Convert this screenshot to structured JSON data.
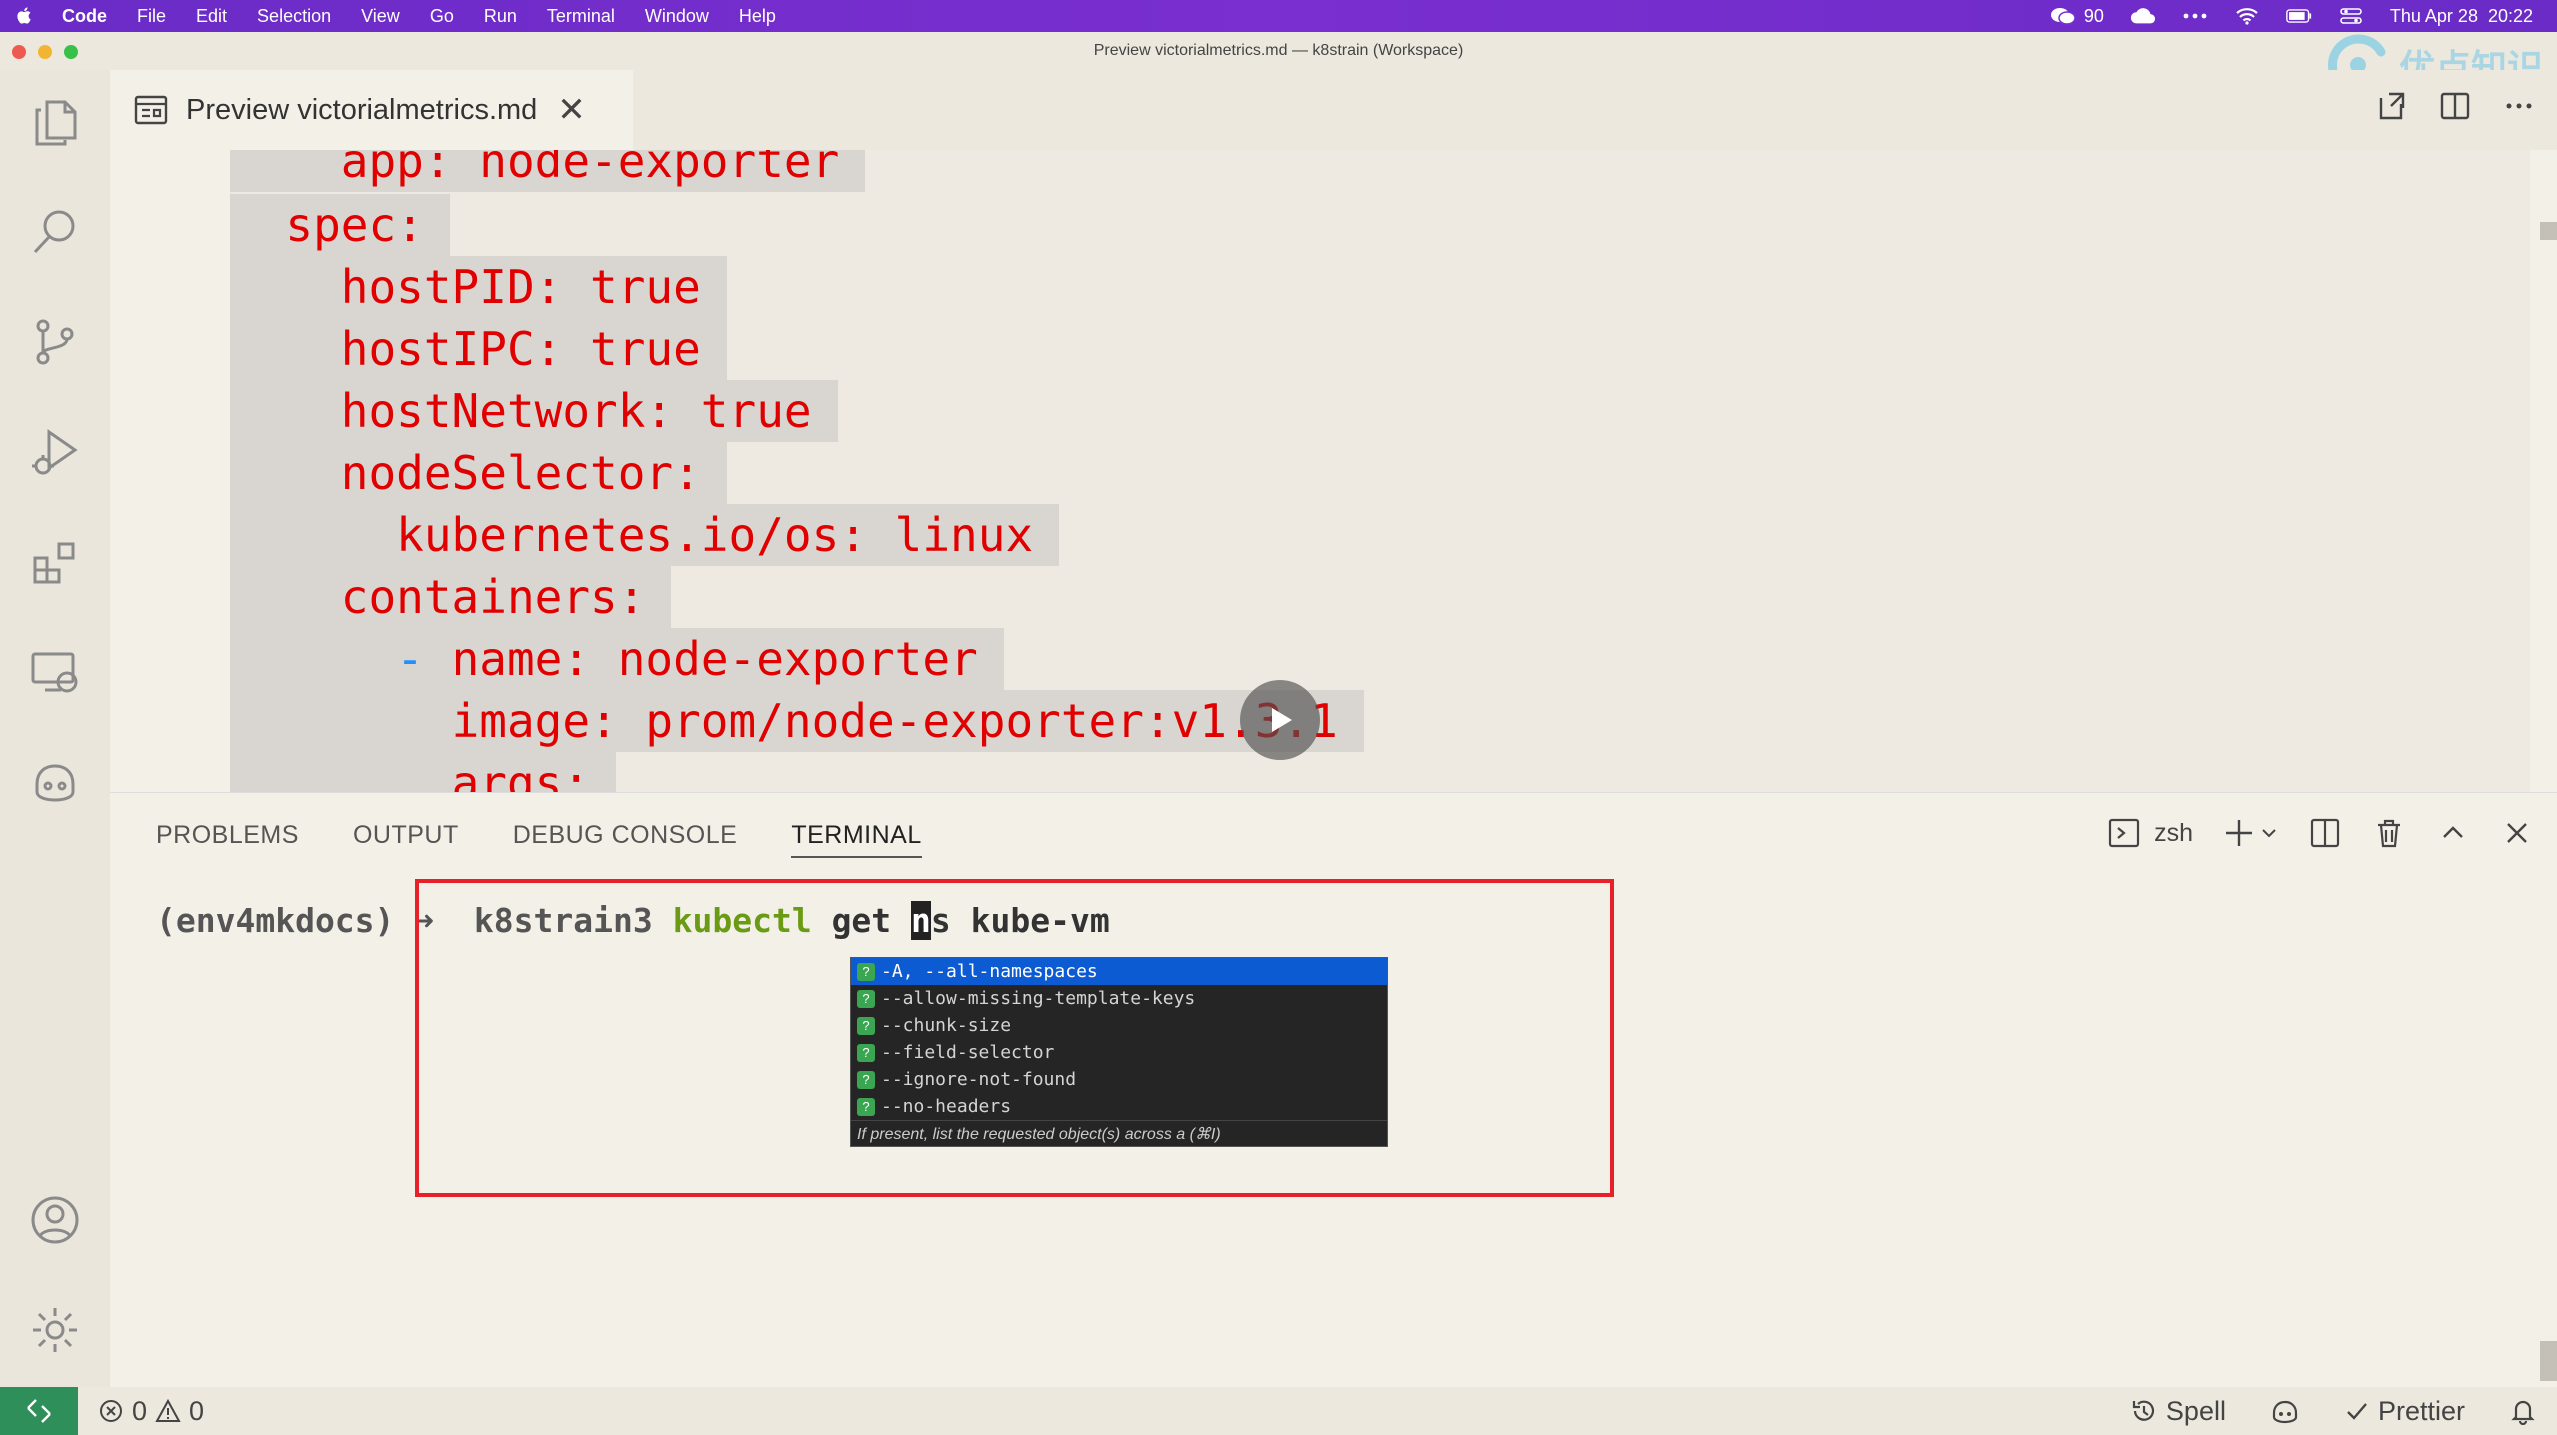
{
  "menubar": {
    "app": "Code",
    "items": [
      "File",
      "Edit",
      "Selection",
      "View",
      "Go",
      "Run",
      "Terminal",
      "Window",
      "Help"
    ],
    "wechat_count": "90",
    "datetime": "Thu Apr 28  20:22"
  },
  "window": {
    "title": "Preview victorialmetrics.md — k8strain (Workspace)"
  },
  "watermark": {
    "text": "优点知识"
  },
  "editor_tab": {
    "label": "Preview victorialmetrics.md",
    "close": "✕"
  },
  "code": {
    "lines": [
      {
        "indent": "    ",
        "text": "app: node-exporter"
      },
      {
        "indent": "  ",
        "text": "spec:"
      },
      {
        "indent": "    ",
        "text": "hostPID: true"
      },
      {
        "indent": "    ",
        "text": "hostIPC: true"
      },
      {
        "indent": "    ",
        "text": "hostNetwork: true"
      },
      {
        "indent": "    ",
        "text": "nodeSelector:"
      },
      {
        "indent": "      ",
        "text": "kubernetes.io/os: linux"
      },
      {
        "indent": "    ",
        "text": "containers:"
      },
      {
        "indent": "      ",
        "dash": "-",
        "text": " name: node-exporter"
      },
      {
        "indent": "        ",
        "text": "image: prom/node-exporter:v1.3.1"
      },
      {
        "indent": "        ",
        "text": "args:"
      }
    ]
  },
  "panel": {
    "tabs": [
      "PROBLEMS",
      "OUTPUT",
      "DEBUG CONSOLE",
      "TERMINAL"
    ],
    "active_tab": "TERMINAL",
    "shell": "zsh"
  },
  "terminal": {
    "prompt_env": "(env4mkdocs)",
    "prompt_arrow": "➜",
    "prompt_dir": "k8strain3",
    "cmd": "kubectl",
    "args_before_cursor": "get ",
    "cursor_char": "n",
    "args_after_cursor": "s kube-vm"
  },
  "suggestions": {
    "items": [
      "-A, --all-namespaces",
      "--allow-missing-template-keys",
      "--chunk-size",
      "--field-selector",
      "--ignore-not-found",
      "--no-headers"
    ],
    "selected_index": 0,
    "detail": "If present, list the requested object(s) across a  (⌘I)"
  },
  "statusbar": {
    "errors": "0",
    "warnings": "0",
    "spell": "Spell",
    "prettier": "Prettier"
  },
  "colors": {
    "menubar": "#7a2fd0",
    "code_text": "#e00000",
    "terminal_cmd": "#6b9a14",
    "highlight_box": "#e8202a",
    "suggest_selected": "#0c5bd2"
  }
}
